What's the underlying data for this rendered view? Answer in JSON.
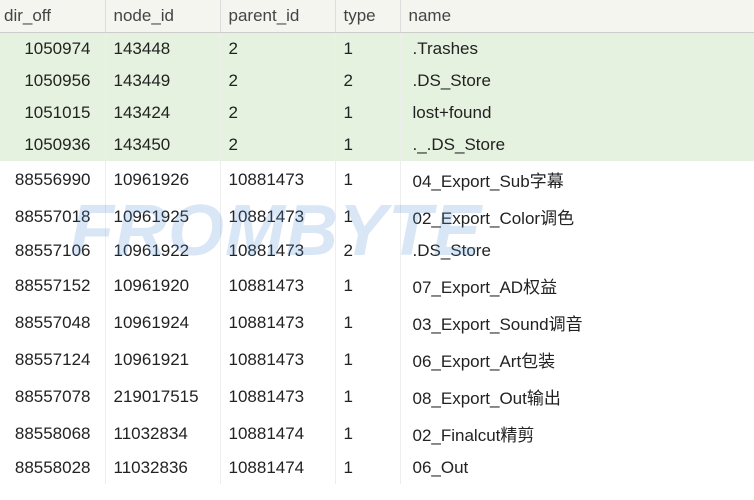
{
  "watermark": "FROMBYTE",
  "columns": {
    "dir_off": "dir_off",
    "node_id": "node_id",
    "parent_id": "parent_id",
    "type": "type",
    "name": "name"
  },
  "chart_data": {
    "type": "table",
    "columns": [
      "dir_off",
      "node_id",
      "parent_id",
      "type",
      "name"
    ],
    "rows": [
      {
        "dir_off": "1050974",
        "node_id": "143448",
        "parent_id": "2",
        "type": "1",
        "name": ".Trashes",
        "highlight": true
      },
      {
        "dir_off": "1050956",
        "node_id": "143449",
        "parent_id": "2",
        "type": "2",
        "name": ".DS_Store",
        "highlight": true
      },
      {
        "dir_off": "1051015",
        "node_id": "143424",
        "parent_id": "2",
        "type": "1",
        "name": "lost+found",
        "highlight": true
      },
      {
        "dir_off": "1050936",
        "node_id": "143450",
        "parent_id": "2",
        "type": "1",
        "name": "._.DS_Store",
        "highlight": true
      },
      {
        "dir_off": "88556990",
        "node_id": "10961926",
        "parent_id": "10881473",
        "type": "1",
        "name": "04_Export_Sub字幕",
        "highlight": false
      },
      {
        "dir_off": "88557018",
        "node_id": "10961925",
        "parent_id": "10881473",
        "type": "1",
        "name": "02_Export_Color调色",
        "highlight": false
      },
      {
        "dir_off": "88557106",
        "node_id": "10961922",
        "parent_id": "10881473",
        "type": "2",
        "name": ".DS_Store",
        "highlight": false
      },
      {
        "dir_off": "88557152",
        "node_id": "10961920",
        "parent_id": "10881473",
        "type": "1",
        "name": "07_Export_AD权益",
        "highlight": false
      },
      {
        "dir_off": "88557048",
        "node_id": "10961924",
        "parent_id": "10881473",
        "type": "1",
        "name": "03_Export_Sound调音",
        "highlight": false
      },
      {
        "dir_off": "88557124",
        "node_id": "10961921",
        "parent_id": "10881473",
        "type": "1",
        "name": "06_Export_Art包装",
        "highlight": false
      },
      {
        "dir_off": "88557078",
        "node_id": "219017515",
        "parent_id": "10881473",
        "type": "1",
        "name": "08_Export_Out输出",
        "highlight": false
      },
      {
        "dir_off": "88558068",
        "node_id": "11032834",
        "parent_id": "10881474",
        "type": "1",
        "name": "02_Finalcut精剪",
        "highlight": false
      },
      {
        "dir_off": "88558028",
        "node_id": "11032836",
        "parent_id": "10881474",
        "type": "1",
        "name": "06_Out",
        "highlight": false
      }
    ]
  }
}
